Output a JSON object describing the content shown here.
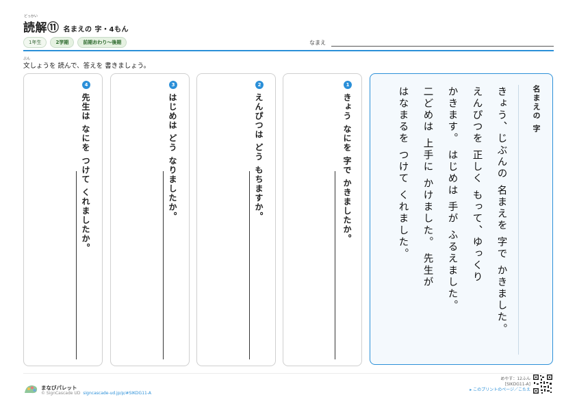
{
  "header": {
    "furigana": "どっかい",
    "title": "読解⑪",
    "subtitle": "名まえの 字・4もん",
    "chips": [
      "1年生",
      "2学期",
      "前期おわり～後期"
    ],
    "name_label": "なまえ"
  },
  "instruction": {
    "furigana": "ぶん",
    "text": "文しょうを 読んで、答えを 書きましょう。"
  },
  "passage": {
    "title": "名まえの 字",
    "lines": [
      "きょう、じぶんの 名まえを 字で かきました。",
      "えんぴつを 正しく もって、ゆっくり",
      "かきます。 はじめは 手が ふるえました。",
      "二どめは 上手に かけました。 先生が",
      "はなまるを つけて くれました。"
    ]
  },
  "questions": [
    {
      "number": "1",
      "text": "きょう なにを 字で かきましたか。"
    },
    {
      "number": "2",
      "text": "えんぴつは どう もちますか。"
    },
    {
      "number": "3",
      "text": "はじめは どう なりましたか。"
    },
    {
      "number": "4",
      "text": "先生は なにを つけて くれましたか。"
    }
  ],
  "footer": {
    "brand": "まなびパレット",
    "copyright": "© SignCascade UD",
    "url": "signcascade-ud.jp/p/#SIKDG11-A",
    "time": "めやす：12ふん",
    "code": "[SIKDG11-A]",
    "link": "▸ このプリントのページ／こたえ"
  },
  "colors": {
    "accent": "#2a8fd8",
    "chip_green": "#2e6b2e",
    "passage_bg": "#f4f9fd"
  }
}
